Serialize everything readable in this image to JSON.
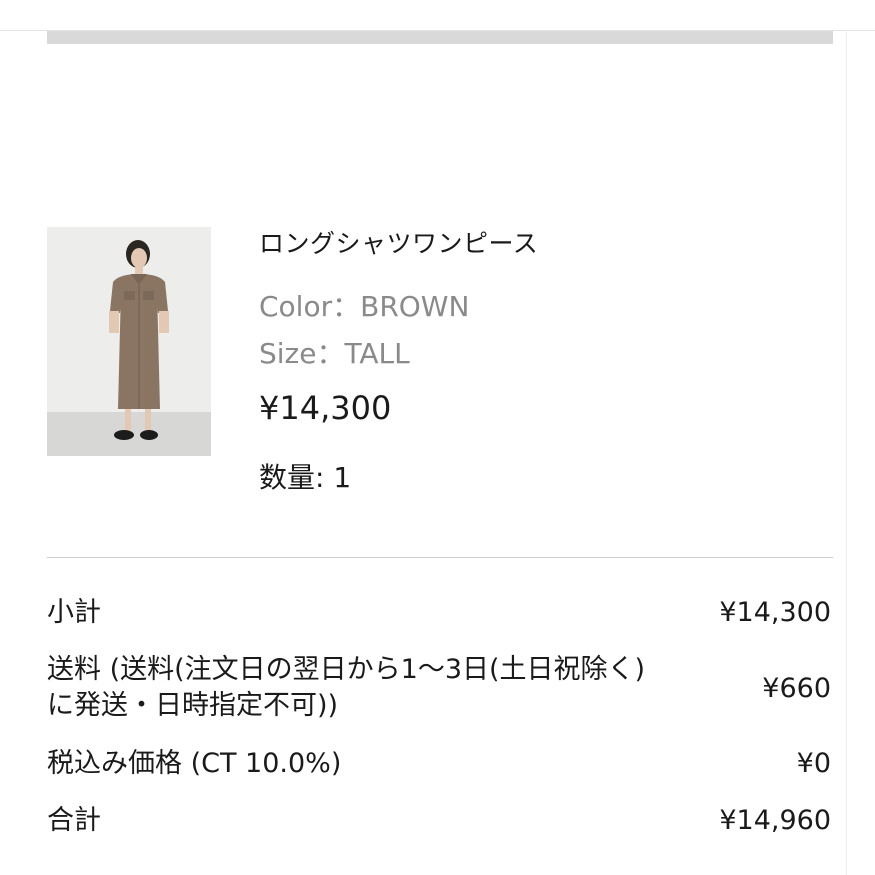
{
  "product": {
    "image_alt": "long shirt dress worn by model",
    "name": "ロングシャツワンピース",
    "color_text": "Color：BROWN",
    "size_text": "Size：TALL",
    "price": "¥14,300",
    "quantity_text": "数量: 1"
  },
  "summary": {
    "subtotal_label": "小計",
    "subtotal_value": "¥14,300",
    "shipping_label": "送料 (送料(注文日の翌日から1〜3日(土日祝除く)に発送・日時指定不可))",
    "shipping_value": "¥660",
    "tax_label": "税込み価格 (CT 10.0%)",
    "tax_value": "¥0",
    "total_label": "合計",
    "total_value": "¥14,960"
  },
  "colors": {
    "text": "#1a1a1a",
    "muted": "#8a8a8a",
    "divider": "#d0d0d0",
    "bar": "#d9d9d9",
    "dress": "#8a7563"
  }
}
